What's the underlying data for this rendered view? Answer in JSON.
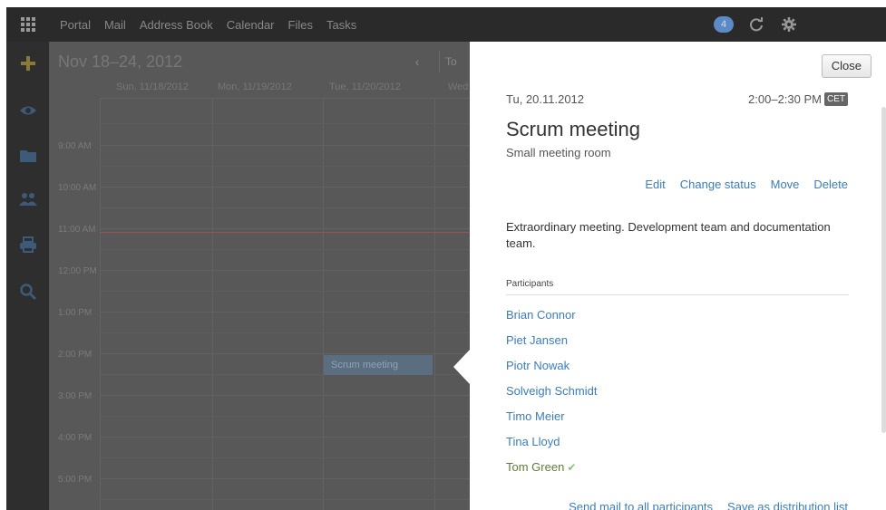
{
  "topbar": {
    "nav": [
      "Portal",
      "Mail",
      "Address Book",
      "Calendar",
      "Files",
      "Tasks"
    ],
    "notification_count": "4",
    "icons": [
      "launcher-grid-icon",
      "refresh-icon",
      "settings-gear-icon"
    ]
  },
  "siderail": {
    "icons": [
      "add-plus-icon",
      "eye-icon",
      "folder-icon",
      "people-icon",
      "print-icon",
      "search-icon"
    ]
  },
  "calendar": {
    "title": "Nov 18–24, 2012",
    "prev": "‹",
    "today": "To",
    "days": [
      "Sun, 11/18/2012",
      "Mon, 11/19/2012",
      "Tue, 11/20/2012",
      "Wed"
    ],
    "times": [
      "9:00 AM",
      "10:00 AM",
      "11:00 AM",
      "12:00 PM",
      "1:00 PM",
      "2:00 PM",
      "3:00 PM",
      "4:00 PM",
      "5:00 PM"
    ],
    "event": "Scrum meeting"
  },
  "detail": {
    "close": "Close",
    "date": "Tu, 20.11.2012",
    "time": "2:00–2:30 PM",
    "timezone": "CET",
    "title": "Scrum meeting",
    "location": "Small meeting room",
    "actions": [
      "Edit",
      "Change status",
      "Move",
      "Delete"
    ],
    "note": "Extraordinary meeting. Development team and documentation team.",
    "participants_label": "Participants",
    "participants": [
      "Brian Connor",
      "Piet Jansen",
      "Piotr Nowak",
      "Solveigh Schmidt",
      "Timo Meier",
      "Tina Lloyd",
      "Tom Green"
    ],
    "footer": [
      "Send mail to all participants",
      "Save as distribution list"
    ]
  },
  "colors": {
    "accent_link": "#3c7cbf",
    "accepted": "#5f7a3a",
    "overlay_dark": "#585858"
  }
}
